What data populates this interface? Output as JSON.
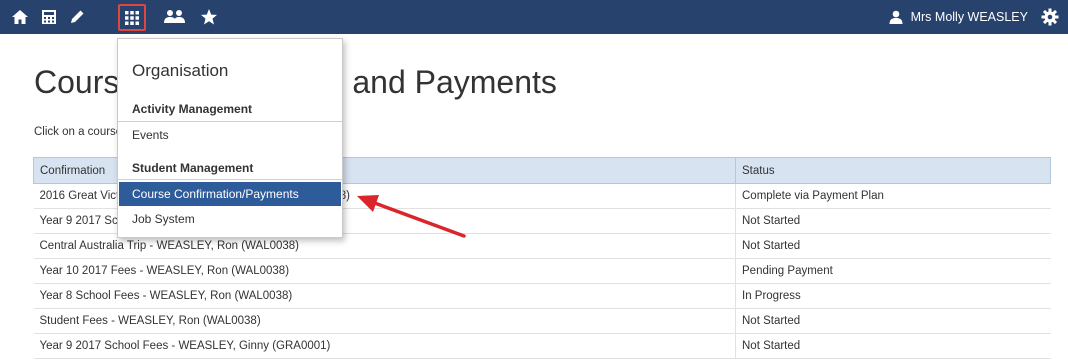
{
  "navbar": {
    "icons": [
      "home-icon",
      "calculator-icon",
      "pencil-icon",
      "grid-icon",
      "people-icon",
      "star-icon"
    ],
    "user_name": "Mrs Molly WEASLEY",
    "settings_icon": "gear-icon",
    "background_color": "#27426d"
  },
  "page": {
    "title": "Course Confirmations and Payments",
    "instruction": "Click on a course confirmation in the list below to proceed."
  },
  "menu": {
    "heading": "Organisation",
    "section1": "Activity Management",
    "events": "Events",
    "section2": "Student Management",
    "course_payments": "Course Confirmation/Payments",
    "job_system": "Job System",
    "active_color": "#2e5c9a"
  },
  "table": {
    "headers": [
      "Confirmation",
      "Status"
    ],
    "rows": [
      {
        "confirmation": "2016 Great Victorian Bike Ride - WEASLEY, Ron (WAL0038)",
        "status": "Complete via Payment Plan"
      },
      {
        "confirmation": "Year 9 2017 School Fees - WEASLEY, Ron (WAL0038)",
        "status": "Not Started"
      },
      {
        "confirmation": "Central Australia Trip - WEASLEY, Ron (WAL0038)",
        "status": "Not Started"
      },
      {
        "confirmation": "Year 10 2017 Fees - WEASLEY, Ron (WAL0038)",
        "status": "Pending Payment"
      },
      {
        "confirmation": "Year 8 School Fees - WEASLEY, Ron (WAL0038)",
        "status": "In Progress"
      },
      {
        "confirmation": "Student Fees - WEASLEY, Ron (WAL0038)",
        "status": "Not Started"
      },
      {
        "confirmation": "Year 9 2017 School Fees - WEASLEY, Ginny (GRA0001)",
        "status": "Not Started"
      }
    ]
  },
  "annotation": {
    "arrow_color": "#d9262b"
  }
}
